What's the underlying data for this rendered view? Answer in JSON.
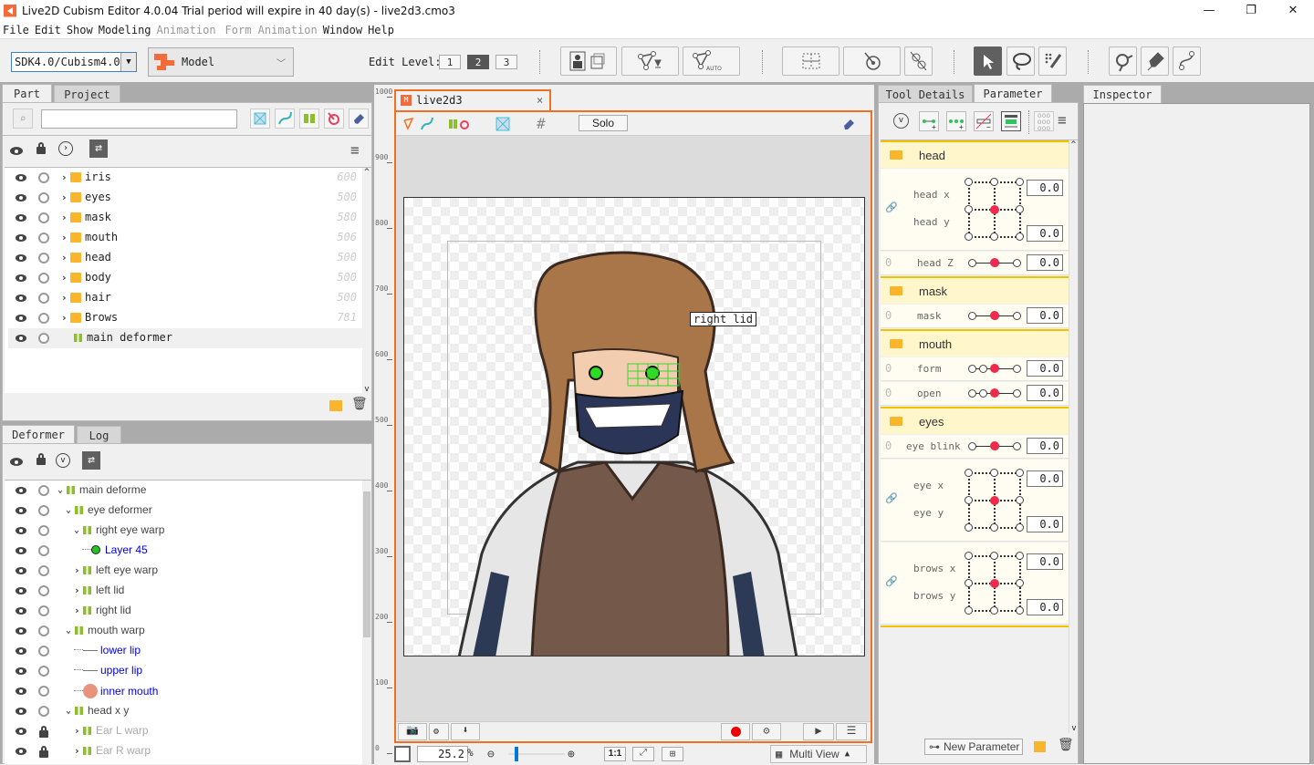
{
  "window": {
    "title": "Live2D Cubism Editor 4.0.04   Trial period will expire in 40 day(s)  - live2d3.cmo3",
    "buttons": {
      "minimize": "—",
      "restore": "❐",
      "close": "✕"
    }
  },
  "menu": [
    {
      "label": "File",
      "enabled": true
    },
    {
      "label": "Edit",
      "enabled": true
    },
    {
      "label": "Show",
      "enabled": true
    },
    {
      "label": "Modeling",
      "enabled": true
    },
    {
      "label": "Animation",
      "enabled": false
    },
    {
      "label": "Form Animation",
      "enabled": false
    },
    {
      "label": "Window",
      "enabled": true
    },
    {
      "label": "Help",
      "enabled": true
    }
  ],
  "toolbar": {
    "sdk_value": "SDK4.0/Cubism4.0",
    "mode_value": "Model",
    "edit_level_label": "Edit Level:",
    "edit_levels": [
      "1",
      "2",
      "3"
    ],
    "edit_level_active": "2",
    "auto_label": "AUTO"
  },
  "part_panel": {
    "tabs": [
      "Part",
      "Project"
    ],
    "active_tab": "Part",
    "search_value": "",
    "items": [
      {
        "label": "iris",
        "type": "folder",
        "draw_order": "600"
      },
      {
        "label": "eyes",
        "type": "folder",
        "draw_order": "500"
      },
      {
        "label": "mask",
        "type": "folder",
        "draw_order": "580"
      },
      {
        "label": "mouth",
        "type": "folder",
        "draw_order": "506"
      },
      {
        "label": "head",
        "type": "folder",
        "draw_order": "500"
      },
      {
        "label": "body",
        "type": "folder",
        "draw_order": "500"
      },
      {
        "label": "hair",
        "type": "folder",
        "draw_order": "500"
      },
      {
        "label": "Brows",
        "type": "folder",
        "draw_order": "781"
      },
      {
        "label": "main deformer",
        "type": "warp",
        "draw_order": ""
      }
    ]
  },
  "deformer_panel": {
    "tabs": [
      "Deformer",
      "Log"
    ],
    "active_tab": "Deformer",
    "items": [
      {
        "label": "main deforme",
        "depth": 0,
        "expander": "open",
        "icon": "warp",
        "style": "normal",
        "locked": false
      },
      {
        "label": "eye deformer",
        "depth": 1,
        "expander": "open",
        "icon": "warp",
        "style": "normal",
        "locked": false
      },
      {
        "label": "right eye warp",
        "depth": 2,
        "expander": "open",
        "icon": "warp",
        "style": "normal",
        "locked": false
      },
      {
        "label": "Layer 45",
        "depth": 3,
        "expander": "none",
        "icon": "art-mesh-green",
        "style": "blue",
        "locked": false
      },
      {
        "label": "left eye warp",
        "depth": 2,
        "expander": "closed",
        "icon": "warp",
        "style": "normal",
        "locked": false
      },
      {
        "label": "left lid",
        "depth": 2,
        "expander": "closed",
        "icon": "warp",
        "style": "normal",
        "locked": false
      },
      {
        "label": "right lid",
        "depth": 2,
        "expander": "closed",
        "icon": "warp",
        "style": "normal",
        "locked": false
      },
      {
        "label": "mouth warp",
        "depth": 1,
        "expander": "open",
        "icon": "warp",
        "style": "normal",
        "locked": false
      },
      {
        "label": "lower lip",
        "depth": 2,
        "expander": "none",
        "icon": "line",
        "style": "blue",
        "locked": false
      },
      {
        "label": "upper lip",
        "depth": 2,
        "expander": "none",
        "icon": "line",
        "style": "blue",
        "locked": false
      },
      {
        "label": "inner mouth",
        "depth": 2,
        "expander": "none",
        "icon": "art-mesh-pink",
        "style": "blue",
        "locked": false
      },
      {
        "label": "head x y",
        "depth": 1,
        "expander": "open",
        "icon": "warp",
        "style": "normal",
        "locked": false
      },
      {
        "label": "Ear L warp",
        "depth": 2,
        "expander": "closed",
        "icon": "warp",
        "style": "gray",
        "locked": true
      },
      {
        "label": "Ear R warp",
        "depth": 2,
        "expander": "closed",
        "icon": "warp",
        "style": "gray",
        "locked": true
      }
    ]
  },
  "view": {
    "tab_label": "live2d3",
    "solo_label": "Solo",
    "ruler_ticks": [
      "1000",
      "900",
      "800",
      "700",
      "600",
      "500",
      "400",
      "300",
      "200",
      "100",
      "0"
    ],
    "tooltip": "right lid",
    "zoom_value": "25.2",
    "zoom_unit": "%",
    "zoom_slider": 0.12,
    "one_to_one_label": "1:1",
    "multi_view_label": "Multi View"
  },
  "right_panel": {
    "tabs": [
      "Tool Details",
      "Parameter"
    ],
    "active_tab": "Parameter",
    "inspector_tab": "Inspector",
    "new_parameter_label": "New Parameter",
    "groups": [
      {
        "name": "head",
        "params": [
          {
            "type": "2d",
            "labels": [
              "head x",
              "head y"
            ],
            "values": [
              "0.0",
              "0.0"
            ],
            "linked": true
          },
          {
            "type": "1d",
            "labels": [
              "head Z"
            ],
            "values": [
              "0.0"
            ],
            "keys": 3,
            "pos": 0.5,
            "linked": false
          }
        ]
      },
      {
        "name": "mask",
        "params": [
          {
            "type": "1d",
            "labels": [
              "mask"
            ],
            "values": [
              "0.0"
            ],
            "keys": 3,
            "pos": 0.5,
            "linked": false
          }
        ]
      },
      {
        "name": "mouth",
        "params": [
          {
            "type": "1d",
            "labels": [
              "form"
            ],
            "values": [
              "0.0"
            ],
            "keys": 4,
            "pos": 0.5,
            "linked": false
          },
          {
            "type": "1d",
            "labels": [
              "open"
            ],
            "values": [
              "0.0"
            ],
            "keys": 4,
            "pos": 0.5,
            "linked": false
          }
        ]
      },
      {
        "name": "eyes",
        "params": [
          {
            "type": "1d",
            "labels": [
              "eye blink"
            ],
            "values": [
              "0.0"
            ],
            "keys": 3,
            "pos": 0.5,
            "linked": false
          },
          {
            "type": "2d",
            "labels": [
              "eye x",
              "eye y"
            ],
            "values": [
              "0.0",
              "0.0"
            ],
            "linked": true
          },
          {
            "type": "2d",
            "labels": [
              "brows x",
              "brows y"
            ],
            "values": [
              "0.0",
              "0.0"
            ],
            "linked": true
          }
        ]
      }
    ]
  },
  "colors": {
    "accent": "#f26b3a",
    "view_border": "#f07020",
    "param_group_bg": "#fff6cc",
    "param_group_border": "#f2c200",
    "key_dot": "#ef2a4c",
    "warp_icon": "#8cbf2a",
    "folder": "#fbb52a",
    "tree_link_blue": "#0000e6"
  }
}
